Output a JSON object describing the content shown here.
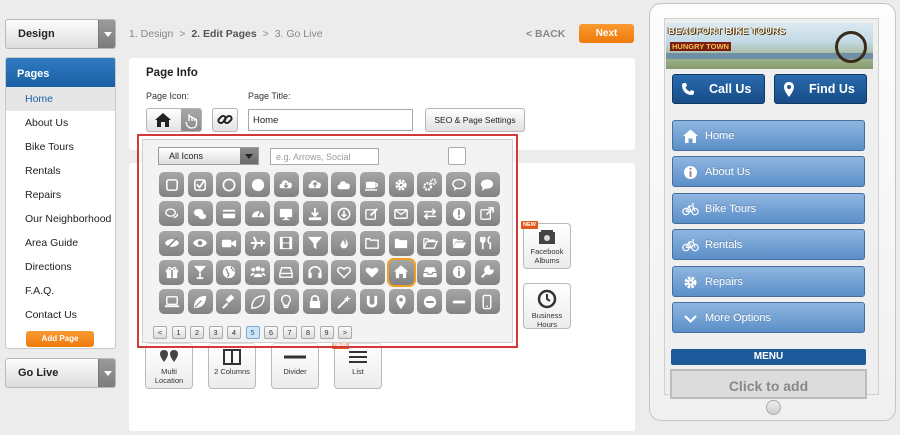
{
  "left": {
    "design_label": "Design",
    "pages_title": "Pages",
    "pages": [
      "Home",
      "About Us",
      "Bike Tours",
      "Rentals",
      "Repairs",
      "Our Neighborhood",
      "Area Guide",
      "Directions",
      "F.A.Q.",
      "Contact Us"
    ],
    "add_page_label": "Add Page",
    "golive_label": "Go Live"
  },
  "steps": {
    "s1": "1. Design",
    "sep1": ">",
    "s2": "2. Edit Pages",
    "sep2": ">",
    "s3": "3. Go Live"
  },
  "nav": {
    "back_label": "< BACK",
    "next_label": "Next"
  },
  "page_info": {
    "title": "Page Info",
    "icon_label": "Page Icon:",
    "title_label": "Page Title:",
    "title_value": "Home",
    "seo_label": "SEO & Page Settings"
  },
  "picker": {
    "category_value": "All Icons",
    "search_placeholder": "e.g. Arrows, Social",
    "pages": [
      "<",
      "1",
      "2",
      "3",
      "4",
      "5",
      "6",
      "7",
      "8",
      "9",
      ">"
    ],
    "current_page": "5",
    "rows": [
      [
        "square-icon",
        "checkbox-icon",
        "circle-outline-icon",
        "circle-icon",
        "cloud-download-icon",
        "cloud-upload-icon",
        "cloud-icon",
        "coffee-icon",
        "gear-icon",
        "gears-icon",
        "speech-bubble-outline-icon",
        "speech-bubble-icon"
      ],
      [
        "chat-outline-icon",
        "chat-icon",
        "credit-card-icon",
        "dashboard-icon",
        "desktop-icon",
        "download-icon",
        "download-circle-icon",
        "edit-icon",
        "envelope-icon",
        "exchange-icon",
        "exclamation-icon",
        "external-link-icon"
      ],
      [
        "eye-slash-icon",
        "eye-icon",
        "video-camera-icon",
        "airplane-icon",
        "film-icon",
        "filter-icon",
        "fire-icon",
        "folder-outline-icon",
        "folder-icon",
        "folder-open-outline-icon",
        "folder-open-icon",
        "restaurant-icon"
      ],
      [
        "gift-icon",
        "cocktail-icon",
        "globe-icon",
        "group-icon",
        "hard-drive-icon",
        "headphones-icon",
        "heart-outline-icon",
        "heart-icon",
        "home-icon",
        "inbox-icon",
        "info-icon",
        "wrench-icon"
      ],
      [
        "laptop-icon",
        "leaf-icon",
        "gavel-icon",
        "leaf-outline-icon",
        "lightbulb-icon",
        "lock-icon",
        "magic-wand-icon",
        "magnet-icon",
        "map-marker-icon",
        "minus-circle-icon",
        "minus-icon",
        "mobile-icon"
      ]
    ],
    "selected_icon": "home-icon"
  },
  "widgets": {
    "facebook": "Facebook Albums",
    "hours": "Business Hours",
    "multi": "Multi Location",
    "columns": "2 Columns",
    "divider": "Divider",
    "list": "List",
    "new_badge": "NEW"
  },
  "phone": {
    "header_title": "BEAUFORT BIKE TOURS",
    "header_sub": "HUNGRY TOWN",
    "call_label": "Call Us",
    "find_label": "Find Us",
    "nav": [
      {
        "label": "Home",
        "icon": "home-icon"
      },
      {
        "label": "About Us",
        "icon": "info-icon"
      },
      {
        "label": "Bike Tours",
        "icon": "bicycle-icon"
      },
      {
        "label": "Rentals",
        "icon": "bicycle-icon"
      },
      {
        "label": "Repairs",
        "icon": "gear-icon"
      },
      {
        "label": "More Options",
        "icon": "chevron-down-icon"
      }
    ],
    "menu_label": "MENU",
    "click_add_label": "Click to add"
  },
  "colors": {
    "accent_orange": "#f28511",
    "brand_blue": "#1d5ea6",
    "picker_border": "#d23a3a",
    "nav_blue": "#6d9dd2"
  }
}
